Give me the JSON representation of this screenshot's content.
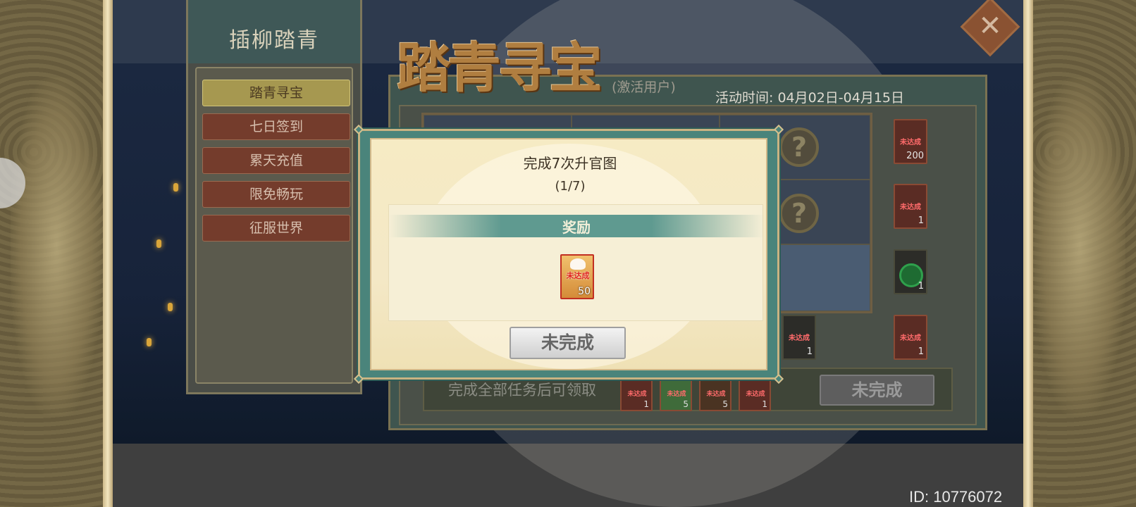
{
  "menu": {
    "title": "插柳踏青",
    "items": [
      {
        "label": "踏青寻宝",
        "active": true
      },
      {
        "label": "七日签到",
        "active": false
      },
      {
        "label": "累天充值",
        "active": false
      },
      {
        "label": "限免畅玩",
        "active": false
      },
      {
        "label": "征服世界",
        "active": false
      }
    ]
  },
  "activity": {
    "title": "踏青寻宝",
    "user_tag": "(激活用户)",
    "time": "活动时间: 04月02日-04月15日",
    "grid_unknown": [
      "?",
      "?"
    ],
    "side_rewards": [
      {
        "stamp": "未达成",
        "count": "200"
      },
      {
        "stamp": "未达成",
        "count": "1"
      },
      {
        "stamp": "",
        "count": "1"
      },
      {
        "stamp": "未达成",
        "count": "1"
      }
    ],
    "inner_reward": {
      "stamp": "未达成",
      "count": "1"
    },
    "bottom_text": "完成全部任务后可领取",
    "bottom_items": [
      {
        "stamp": "未达成",
        "count": "1"
      },
      {
        "stamp": "未达成",
        "count": "5"
      },
      {
        "stamp": "未达成",
        "count": "5"
      },
      {
        "stamp": "未达成",
        "count": "1"
      }
    ],
    "bottom_button": "未完成"
  },
  "modal": {
    "title": "完成7次升官图",
    "progress": "(1/7)",
    "reward_header": "奖励",
    "reward_item": {
      "stamp": "未达成",
      "count": "50"
    },
    "button": "未完成"
  },
  "footer": {
    "id": "ID: 10776072"
  },
  "close_glyph": "✕",
  "colors": {
    "menu_active": "#a69850",
    "menu_item": "#743c2c",
    "modal_frame": "#4a847b",
    "modal_paper": "#f6ebc4"
  }
}
